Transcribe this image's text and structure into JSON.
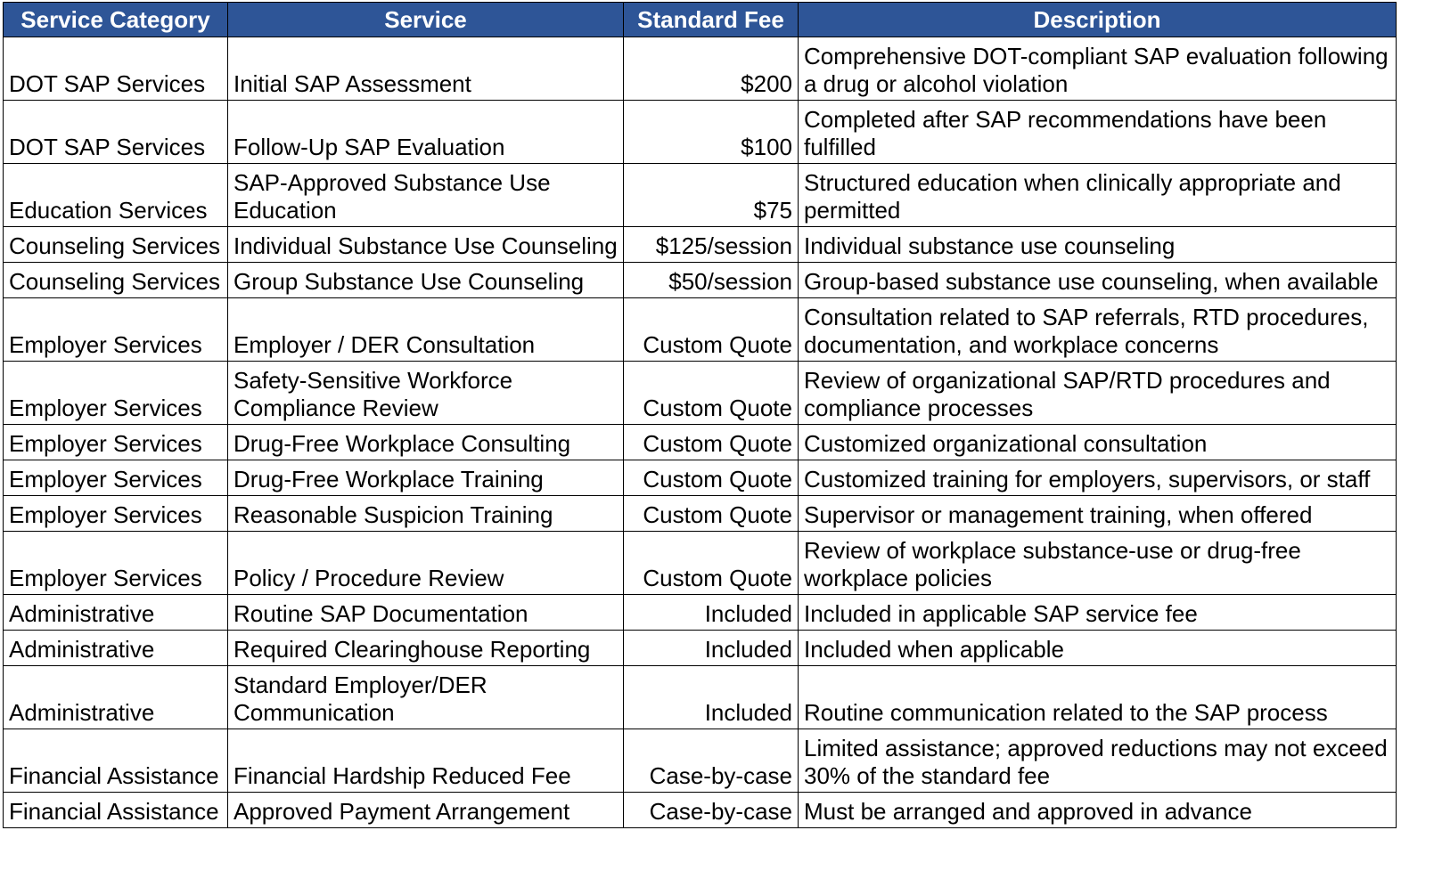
{
  "table": {
    "headers": [
      "Service Category",
      "Service",
      "Standard Fee",
      "Description"
    ],
    "rows": [
      {
        "category": "DOT SAP Services",
        "service": "Initial SAP Assessment",
        "fee": "$200",
        "description": "Comprehensive DOT-compliant SAP evaluation following a drug or alcohol violation"
      },
      {
        "category": "DOT SAP Services",
        "service": "Follow-Up SAP Evaluation",
        "fee": "$100",
        "description": "Completed after SAP recommendations have been fulfilled"
      },
      {
        "category": "Education Services",
        "service": "SAP-Approved Substance Use Education",
        "fee": "$75",
        "description": "Structured education when clinically appropriate and permitted"
      },
      {
        "category": "Counseling Services",
        "service": "Individual Substance Use Counseling",
        "fee": "$125/session",
        "description": "Individual substance use counseling"
      },
      {
        "category": "Counseling Services",
        "service": "Group Substance Use Counseling",
        "fee": "$50/session",
        "description": "Group-based substance use counseling, when available"
      },
      {
        "category": "Employer Services",
        "service": "Employer / DER Consultation",
        "fee": "Custom Quote",
        "description": "Consultation related to SAP referrals, RTD procedures, documentation, and workplace concerns"
      },
      {
        "category": "Employer Services",
        "service": "Safety-Sensitive Workforce Compliance Review",
        "fee": "Custom Quote",
        "description": "Review of organizational SAP/RTD procedures and compliance processes"
      },
      {
        "category": "Employer Services",
        "service": "Drug-Free Workplace Consulting",
        "fee": "Custom Quote",
        "description": "Customized organizational consultation"
      },
      {
        "category": "Employer Services",
        "service": "Drug-Free Workplace Training",
        "fee": "Custom Quote",
        "description": "Customized training for employers, supervisors, or staff"
      },
      {
        "category": "Employer Services",
        "service": "Reasonable Suspicion Training",
        "fee": "Custom Quote",
        "description": "Supervisor or management training, when offered"
      },
      {
        "category": "Employer Services",
        "service": "Policy / Procedure Review",
        "fee": "Custom Quote",
        "description": "Review of workplace substance-use or drug-free workplace policies"
      },
      {
        "category": "Administrative",
        "service": "Routine SAP Documentation",
        "fee": "Included",
        "description": "Included in applicable SAP service fee"
      },
      {
        "category": "Administrative",
        "service": "Required Clearinghouse Reporting",
        "fee": "Included",
        "description": "Included when applicable"
      },
      {
        "category": "Administrative",
        "service": "Standard Employer/DER Communication",
        "fee": "Included",
        "description": "Routine communication related to the SAP process"
      },
      {
        "category": "Financial Assistance",
        "service": "Financial Hardship Reduced Fee",
        "fee": "Case-by-case",
        "description": "Limited assistance; approved reductions may not exceed 30% of the standard fee"
      },
      {
        "category": "Financial Assistance",
        "service": "Approved Payment Arrangement",
        "fee": "Case-by-case",
        "description": "Must be arranged and approved in advance"
      }
    ]
  },
  "colors": {
    "header_background": "#2e5597",
    "header_text": "#ffffff",
    "grid_lines": "#000000"
  }
}
